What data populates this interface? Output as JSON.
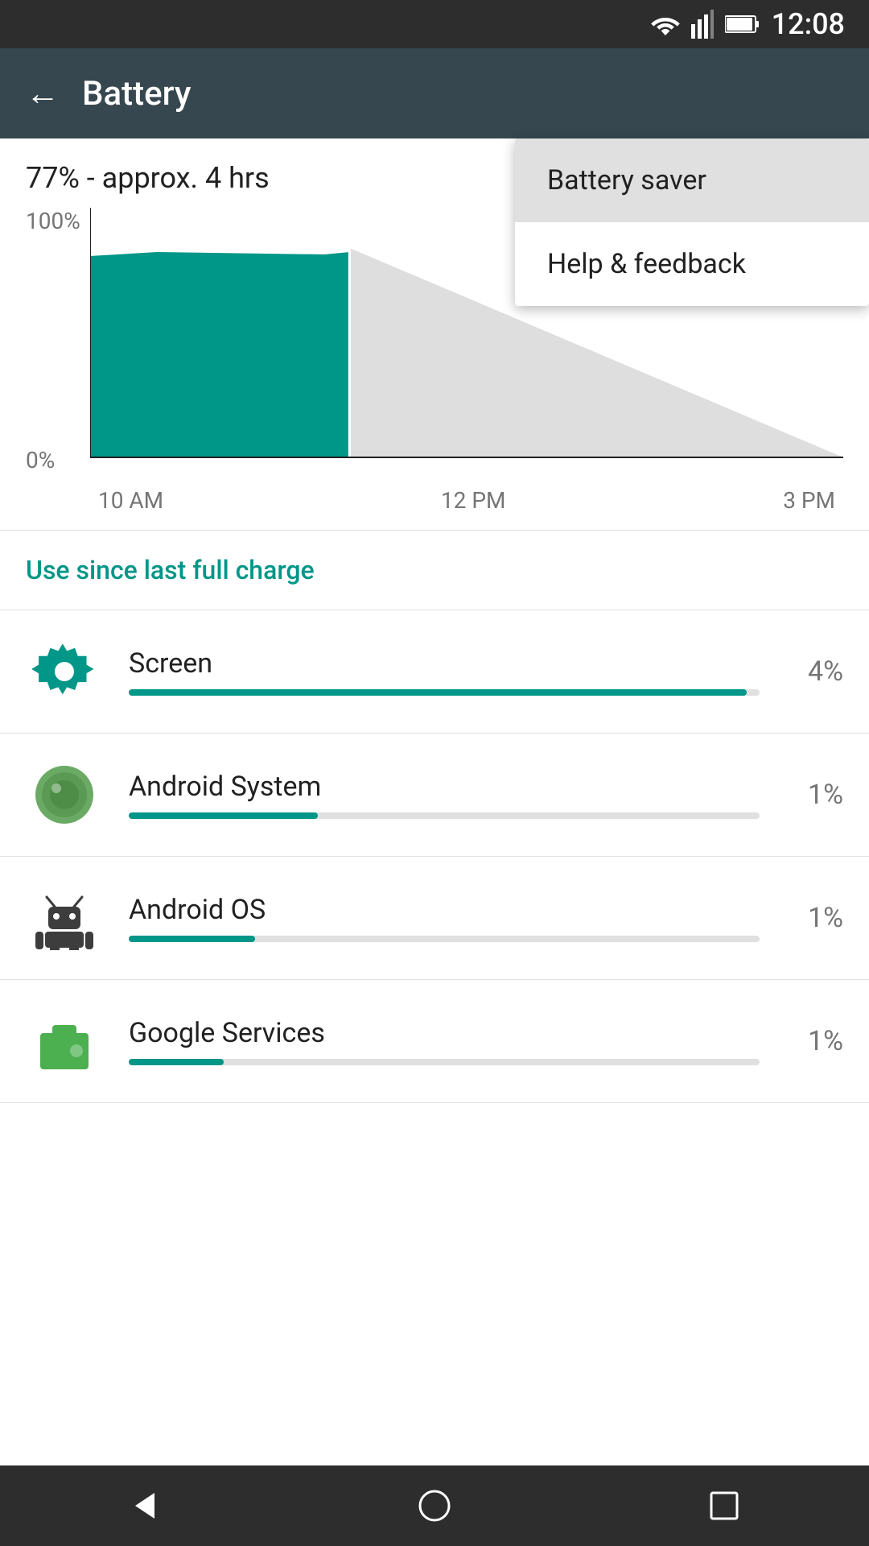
{
  "statusBar": {
    "time": "12:08"
  },
  "appBar": {
    "title": "Battery",
    "backLabel": "←"
  },
  "batteryStatus": {
    "text": "77% - approx. 4 hrs"
  },
  "chart": {
    "yLabels": [
      "100%",
      "0%"
    ],
    "xLabels": [
      "10 AM",
      "12 PM",
      "3 PM"
    ]
  },
  "useSinceLabel": "Use since last full charge",
  "usageItems": [
    {
      "name": "Screen",
      "percent": "4%",
      "barWidth": "98",
      "iconType": "screen"
    },
    {
      "name": "Android System",
      "percent": "1%",
      "barWidth": "30",
      "iconType": "android-system"
    },
    {
      "name": "Android OS",
      "percent": "1%",
      "barWidth": "20",
      "iconType": "android-os"
    },
    {
      "name": "Google Services",
      "percent": "1%",
      "barWidth": "15",
      "iconType": "google-services"
    }
  ],
  "dropdownMenu": {
    "items": [
      {
        "label": "Battery saver"
      },
      {
        "label": "Help & feedback"
      }
    ]
  },
  "navBar": {
    "back": "◁",
    "home": "○",
    "recent": "□"
  }
}
